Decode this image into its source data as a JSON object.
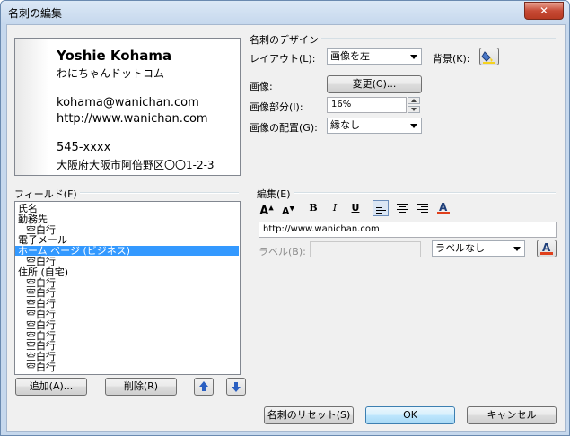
{
  "window": {
    "title": "名刺の編集",
    "close_label": "✕"
  },
  "card": {
    "name": "Yoshie Kohama",
    "company": "わにちゃんドットコム",
    "email": "kohama@wanichan.com",
    "url": "http://www.wanichan.com",
    "postal": "545-xxxx",
    "address": "大阪府大阪市阿倍野区〇〇1-2-3"
  },
  "design": {
    "group_title": "名刺のデザイン",
    "layout_label": "レイアウト(L):",
    "layout_value": "画像を左",
    "background_label": "背景(K):",
    "image_label": "画像:",
    "change_button": "変更(C)...",
    "image_area_label": "画像部分(I):",
    "image_area_value": "16%",
    "image_position_label": "画像の配置(G):",
    "image_position_value": "縁なし"
  },
  "fields": {
    "label": "フィールド(F)",
    "items": [
      "氏名",
      "勤務先",
      "空白行",
      "電子メール",
      "ホーム ページ (ビジネス)",
      "空白行",
      "住所 (自宅)",
      "空白行",
      "空白行",
      "空白行",
      "空白行",
      "空白行",
      "空白行",
      "空白行",
      "空白行",
      "空白行"
    ],
    "selected_index": 4,
    "add_button": "追加(A)...",
    "delete_button": "削除(R)"
  },
  "edit": {
    "group_title": "編集(E)",
    "text_value": "http://www.wanichan.com",
    "label_label": "ラベル(B):",
    "label_position_value": "ラベルなし"
  },
  "buttons": {
    "reset": "名刺のリセット(S)",
    "ok": "OK",
    "cancel": "キャンセル"
  },
  "colors": {
    "selection": "#3399ff",
    "font_color_bar": "#e0401c"
  }
}
